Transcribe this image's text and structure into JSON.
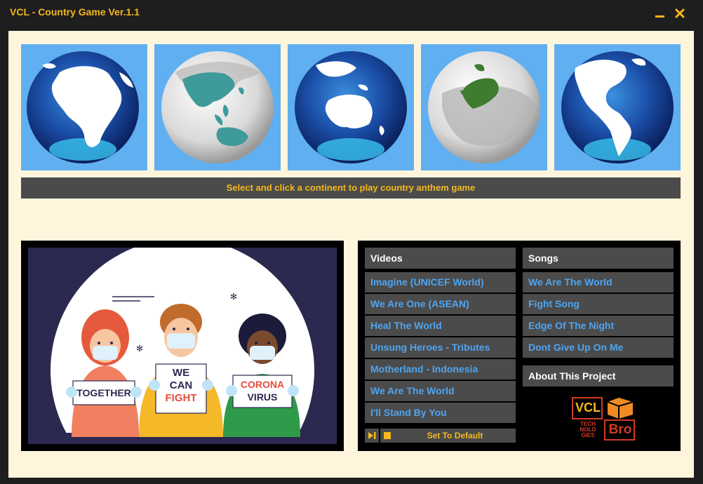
{
  "window": {
    "title": "VCL - Country Game Ver.1.1",
    "minimize_icon": "minimize-icon",
    "close_icon": "close-icon"
  },
  "continents": [
    {
      "name": "Africa",
      "icon": "africa-globe"
    },
    {
      "name": "Asia",
      "icon": "asia-globe"
    },
    {
      "name": "Australia",
      "icon": "australia-globe"
    },
    {
      "name": "Europe",
      "icon": "europe-globe"
    },
    {
      "name": "America",
      "icon": "america-globe"
    }
  ],
  "instruction": "Select and click a continent to play country anthem game",
  "illustration": {
    "sign_left": "TOGETHER",
    "sign_middle_line1": "WE",
    "sign_middle_line2": "CAN",
    "sign_middle_line3": "FIGHT",
    "sign_right_line1": "CORONA",
    "sign_right_line2": "VIRUS"
  },
  "videos": {
    "header": "Videos",
    "items": [
      "Imagine (UNICEF World)",
      "We Are One (ASEAN)",
      "Heal The World",
      "Unsung Heroes - Tributes",
      "Motherland - Indonesia",
      "We Are The World",
      "I'll Stand By You"
    ]
  },
  "songs": {
    "header": "Songs",
    "items": [
      "We Are The World",
      "Fight Song",
      "Edge Of The Night",
      "Dont Give Up On Me"
    ]
  },
  "about": "About This Project",
  "controls": {
    "play_icon": "play-next-icon",
    "stop_icon": "stop-icon",
    "default_label": "Set To Default"
  },
  "logo": {
    "line1": "VCL",
    "line2": "TECH",
    "line3": "NOLO",
    "line4": "GIES",
    "line5": "Bro"
  },
  "colors": {
    "accent": "#f5b81c",
    "panel": "#4b4b4b",
    "link": "#4ea5f0",
    "background": "#fff5dc",
    "tile": "#60aff0"
  }
}
